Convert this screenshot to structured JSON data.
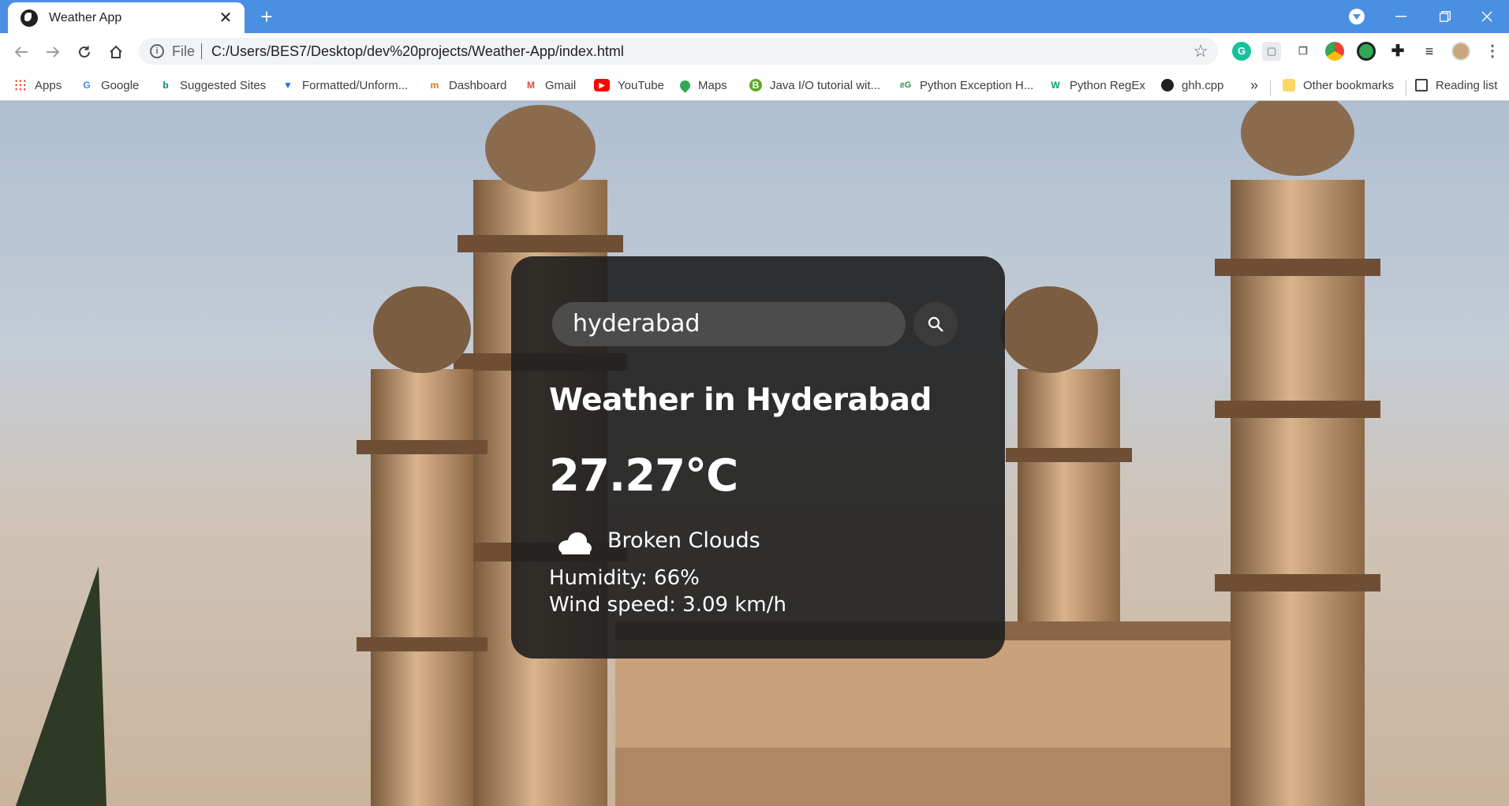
{
  "browser": {
    "tab_title": "Weather App",
    "tab_close": "✕",
    "new_tab": "+",
    "omnibox": {
      "scheme_label": "File",
      "url": "C:/Users/BES7/Desktop/dev%20projects/Weather-App/index.html"
    },
    "bookmarks": [
      {
        "label": "Apps",
        "icon": "apps-grid-icon"
      },
      {
        "label": "Google",
        "icon": "google-icon"
      },
      {
        "label": "Suggested Sites",
        "icon": "bing-icon"
      },
      {
        "label": "Formatted/Unform...",
        "icon": "funnel-icon"
      },
      {
        "label": "Dashboard",
        "icon": "dashboard-icon"
      },
      {
        "label": "Gmail",
        "icon": "gmail-icon"
      },
      {
        "label": "YouTube",
        "icon": "youtube-icon"
      },
      {
        "label": "Maps",
        "icon": "maps-pin-icon"
      },
      {
        "label": "Java I/O tutorial wit...",
        "icon": "b-circle-icon"
      },
      {
        "label": "Python Exception H...",
        "icon": "geeks-icon"
      },
      {
        "label": "Python RegEx",
        "icon": "w3-icon"
      },
      {
        "label": "ghh.cpp",
        "icon": "globe-icon"
      }
    ],
    "overflow": "»",
    "other_bookmarks": "Other bookmarks",
    "reading_list": "Reading list",
    "accent_color": "#4a90e2"
  },
  "app": {
    "search_value": "hyderabad",
    "city_heading": "Weather in Hyderabad",
    "temperature": "27.27°C",
    "description": "Broken Clouds",
    "humidity": "Humidity: 66%",
    "wind": "Wind speed: 3.09 km/h",
    "weather_icon": "cloud-icon"
  }
}
